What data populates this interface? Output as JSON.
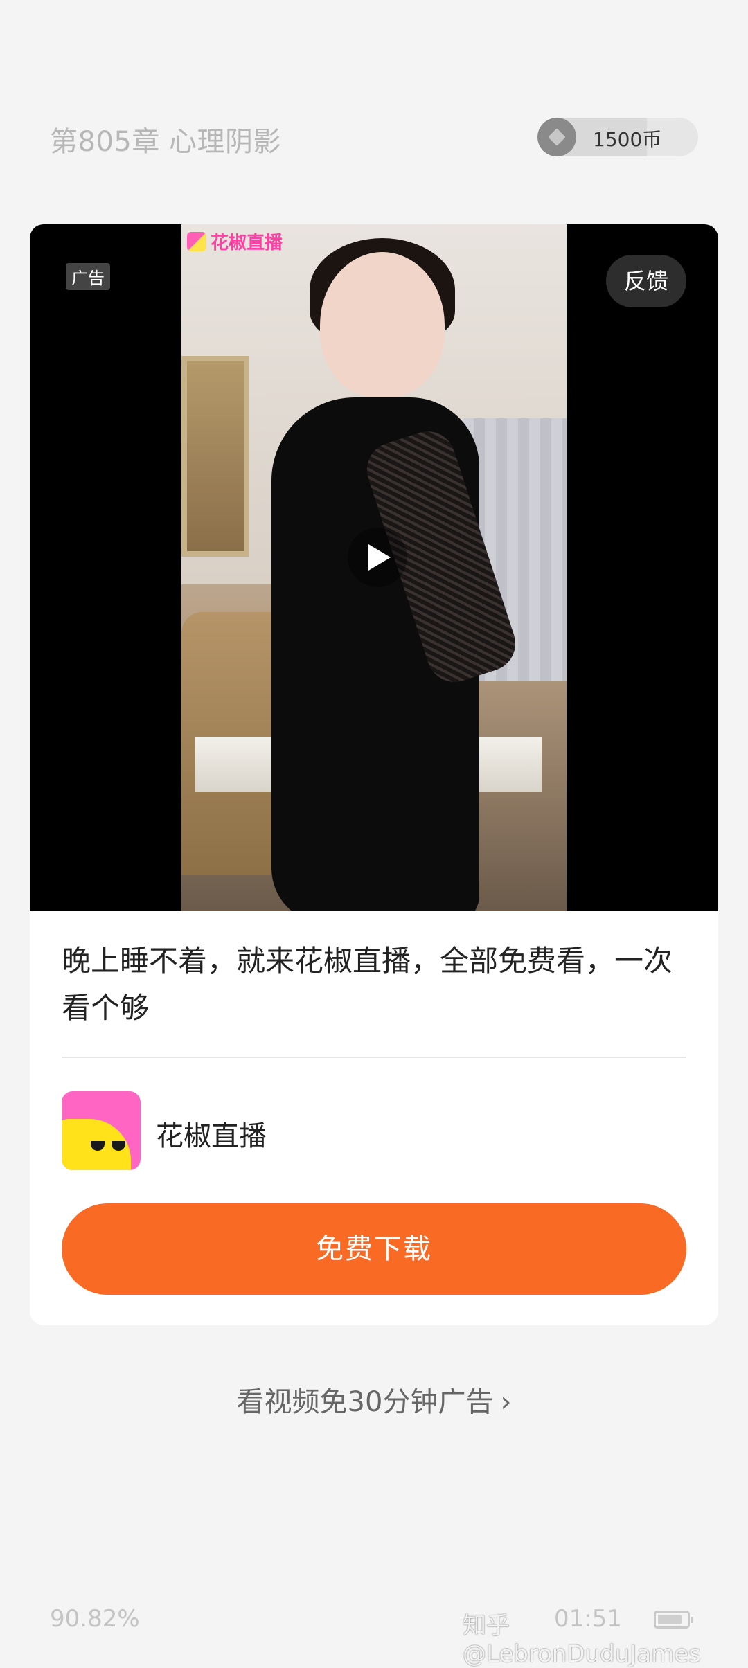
{
  "header": {
    "chapter_title": "第805章 心理阴影",
    "coins": "1500币"
  },
  "ad": {
    "badge": "广告",
    "feedback_label": "反馈",
    "video_logo_text": "花椒直播",
    "description": "晚上睡不着，就来花椒直播，全部免费看，一次看个够",
    "app_name": "花椒直播",
    "download_label": "免费下载"
  },
  "watch_video": {
    "label": "看视频免30分钟广告",
    "chevron": "›"
  },
  "footer": {
    "progress": "90.82%",
    "time": "01:51",
    "watermark": "知乎 @LebronDuduJames"
  },
  "colors": {
    "background": "#f4f4f4",
    "accent": "#f96a25",
    "brand_pink": "#ff3fa3"
  }
}
